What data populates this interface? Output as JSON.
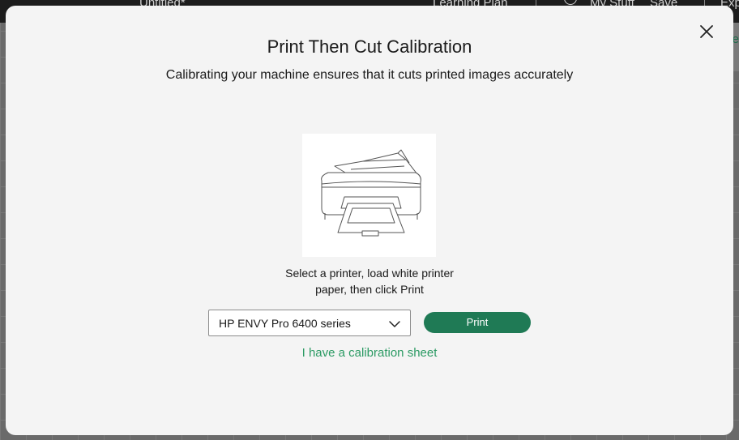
{
  "background_app": {
    "file_title": "Untitled*",
    "learning_plan": "Learning Plan",
    "my_stuff": "My Stuff",
    "save": "Save",
    "export_partial": "Exp",
    "panel_tab_partial": "e"
  },
  "modal": {
    "title": "Print Then Cut Calibration",
    "subtitle": "Calibrating your machine ensures that it cuts printed images accurately",
    "instruction_line1": "Select a printer, load white printer",
    "instruction_line2": "paper, then click Print",
    "printer_select": {
      "value": "HP ENVY Pro 6400 series",
      "icon": "chevron-down-icon"
    },
    "print_button": "Print",
    "calibration_link": "I have a calibration sheet",
    "close_icon": "close-icon",
    "illustration": "printer-illustration"
  },
  "colors": {
    "accent": "#1f7a55",
    "link": "#2b9a63",
    "modal_bg": "#f4f4f4",
    "header_bg": "#1d1d1d"
  }
}
